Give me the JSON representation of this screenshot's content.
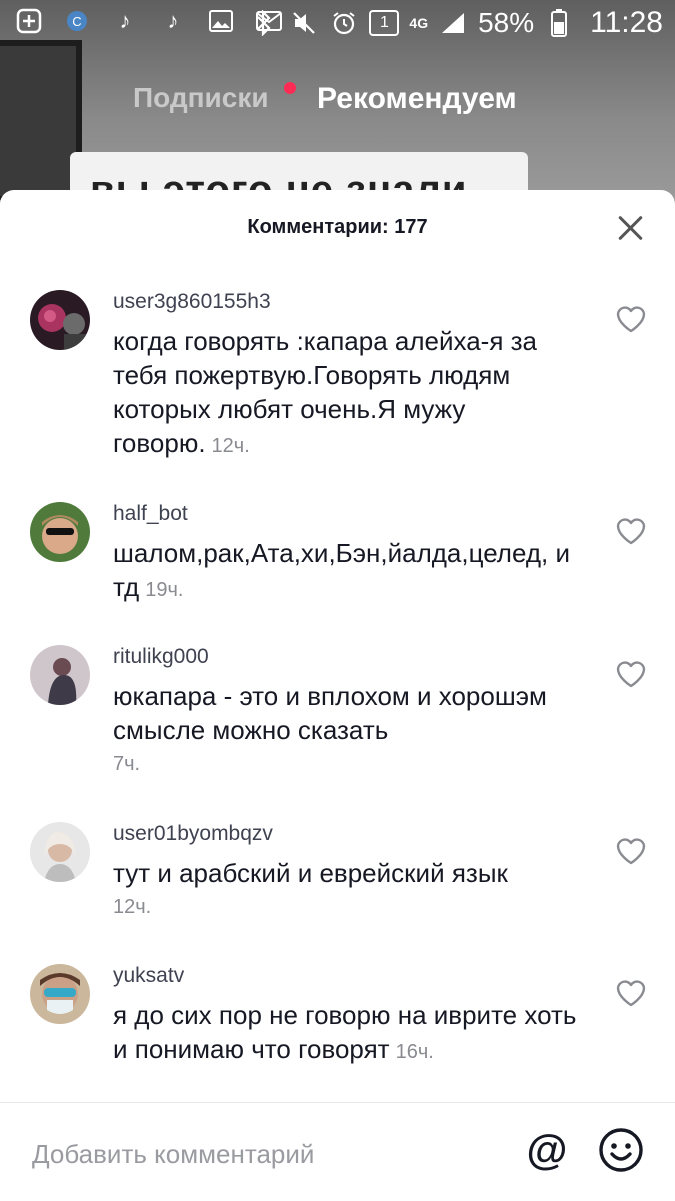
{
  "status_bar": {
    "battery": "58%",
    "time": "11:28",
    "network": "4G",
    "sim_badge": "1"
  },
  "tabs": {
    "following": "Подписки",
    "for_you": "Рекомендуем"
  },
  "background": {
    "card_text": "вы этого не знали"
  },
  "comments_panel": {
    "title": "Комментарии: 177",
    "comments": [
      {
        "user": "user3g860155h3",
        "text": "когда говорять :капара алейха-я за тебя пожертвую.Говорять людям которых любят очень.Я мужу говорю.",
        "time": "12ч."
      },
      {
        "user": "half_bot",
        "text": "шалом,рак,Ата,хи,Бэн,йалда,целед, и тд",
        "time": "19ч."
      },
      {
        "user": "ritulikg000",
        "text": "юкапара - это и вплохом и хорошэм смысле можно сказать",
        "time": "7ч."
      },
      {
        "user": "user01byombqzv",
        "text": "тут и арабский и еврейский язык",
        "time": "12ч."
      },
      {
        "user": "yuksatv",
        "text": "я до сих пор не говорю на иврите хоть и понимаю что говорят",
        "time": "16ч."
      }
    ]
  },
  "input": {
    "placeholder": "Добавить комментарий",
    "mention_symbol": "@"
  },
  "colors": {
    "accent_dot": "#fe2c55",
    "text_primary": "#161823",
    "text_secondary": "#8a8b91"
  }
}
